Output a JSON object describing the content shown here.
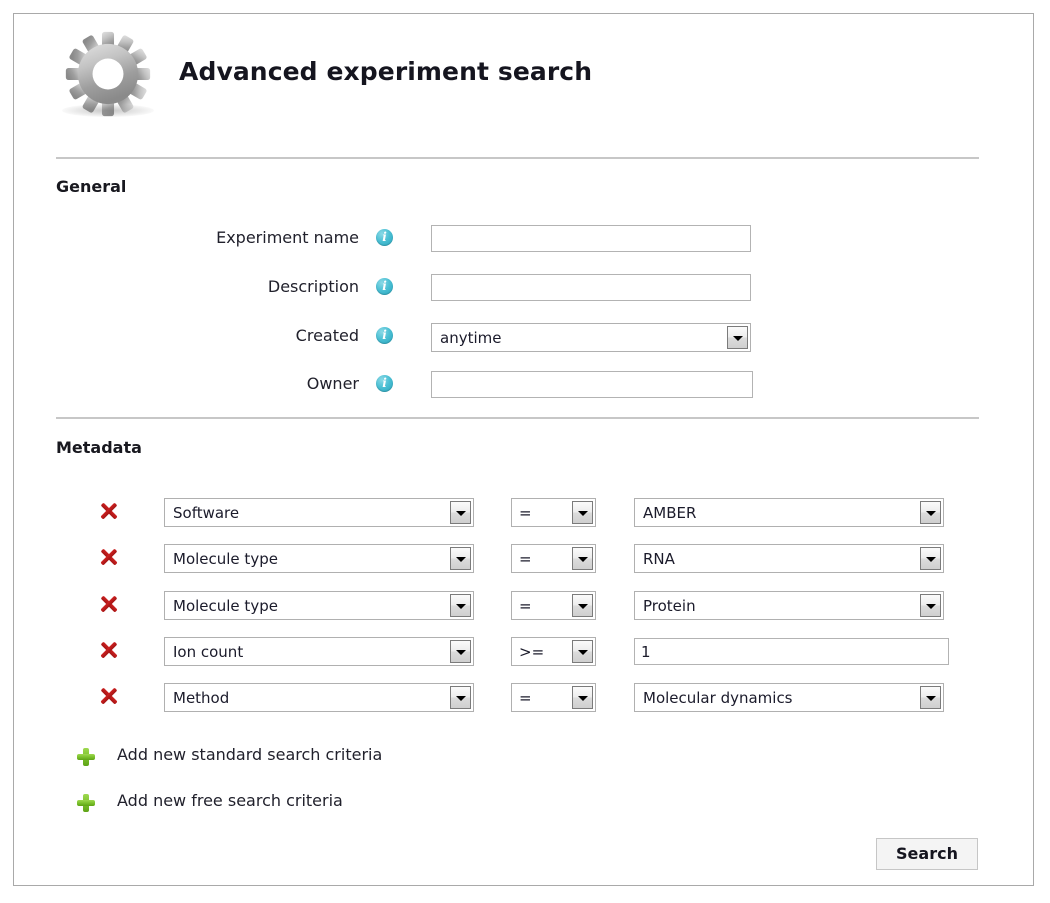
{
  "header": {
    "title": "Advanced experiment search",
    "icon": "gear-icon"
  },
  "sections": {
    "general": {
      "heading": "General",
      "rows": [
        {
          "label": "Experiment name",
          "info_icon": "info-icon",
          "control": "text",
          "value": "",
          "placeholder": ""
        },
        {
          "label": "Description",
          "info_icon": "info-icon",
          "control": "text",
          "value": "",
          "placeholder": ""
        },
        {
          "label": "Created",
          "info_icon": "info-icon",
          "control": "select",
          "value": "anytime"
        },
        {
          "label": "Owner",
          "info_icon": "info-icon",
          "control": "text",
          "value": "",
          "placeholder": ""
        }
      ]
    },
    "metadata": {
      "heading": "Metadata",
      "delete_icon": "delete-icon",
      "rows": [
        {
          "field": "Software",
          "operator": "=",
          "control": "select",
          "value": "AMBER"
        },
        {
          "field": "Molecule type",
          "operator": "=",
          "control": "select",
          "value": "RNA"
        },
        {
          "field": "Molecule type",
          "operator": "=",
          "control": "select",
          "value": "Protein"
        },
        {
          "field": "Ion count",
          "operator": ">=",
          "control": "text",
          "value": "1"
        },
        {
          "field": "Method",
          "operator": "=",
          "control": "select",
          "value": "Molecular dynamics"
        }
      ],
      "add_links": [
        {
          "icon": "plus-icon",
          "label": "Add new standard search criteria"
        },
        {
          "icon": "plus-icon",
          "label": "Add new free search criteria"
        }
      ]
    }
  },
  "actions": {
    "search_label": "Search"
  },
  "colors": {
    "frame_border": "#a9a9a9",
    "rule": "#c7c7c7",
    "info_icon": "#27a5bd",
    "delete_icon": "#b31818",
    "add_icon": "#79bf2a",
    "text": "#1b1b2b"
  }
}
